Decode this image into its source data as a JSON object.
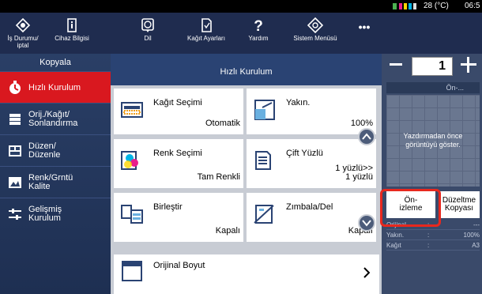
{
  "status": {
    "temperature": "28 (°C)",
    "time": "06:5"
  },
  "toolbar": {
    "items": [
      {
        "label": "İş Durumu/\niptal",
        "icon": "job-status-icon"
      },
      {
        "label": "Cihaz Bilgisi",
        "icon": "device-info-icon"
      },
      {
        "label": "Dil",
        "icon": "language-icon"
      },
      {
        "label": "Kağıt Ayarları",
        "icon": "paper-settings-icon"
      },
      {
        "label": "Yardım",
        "icon": "help-icon"
      },
      {
        "label": "Sistem Menüsü",
        "icon": "system-menu-icon"
      },
      {
        "label": "•••",
        "icon": "more-icon"
      }
    ]
  },
  "sidebar": {
    "title": "Kopyala",
    "items": [
      {
        "label": "Hızlı Kurulum",
        "active": true
      },
      {
        "label": "Orij./Kağıt/\nSonlandırma",
        "active": false
      },
      {
        "label": "Düzen/\nDüzenle",
        "active": false
      },
      {
        "label": "Renk/Grntü\nKalite",
        "active": false
      },
      {
        "label": "Gelişmiş\nKurulum",
        "active": false
      }
    ]
  },
  "main": {
    "header": "Hızlı Kurulum",
    "tiles": [
      {
        "title": "Kağıt Seçimi",
        "value": "Otomatik"
      },
      {
        "title": "Yakın.",
        "value": "100%"
      },
      {
        "title": "Renk Seçimi",
        "value": "Tam Renkli"
      },
      {
        "title": "Çift Yüzlü",
        "value": "1 yüzlü>>\n1 yüzlü"
      },
      {
        "title": "Birleştir",
        "value": "Kapalı"
      },
      {
        "title": "Zımbala/Del",
        "value": "Kapalı"
      },
      {
        "title": "Orijinal Boyut",
        "value": ""
      }
    ]
  },
  "right": {
    "copies": "1",
    "preview_header": "Ön-...",
    "preview_message": "Yazdırmadan önce\ngörüntüyü göster.",
    "preview_button": "Ön-\nizleme",
    "correction_button": "Düzeltme\nKopyası",
    "info": [
      {
        "key": "Orijinal",
        "value": "---"
      },
      {
        "key": "Yakın.",
        "value": "100%"
      },
      {
        "key": "Kağıt",
        "value": "A3"
      }
    ]
  },
  "colors": {
    "toolbar": "#1f2c4f",
    "active": "#d9181f",
    "highlight_ring": "#e8281e"
  }
}
